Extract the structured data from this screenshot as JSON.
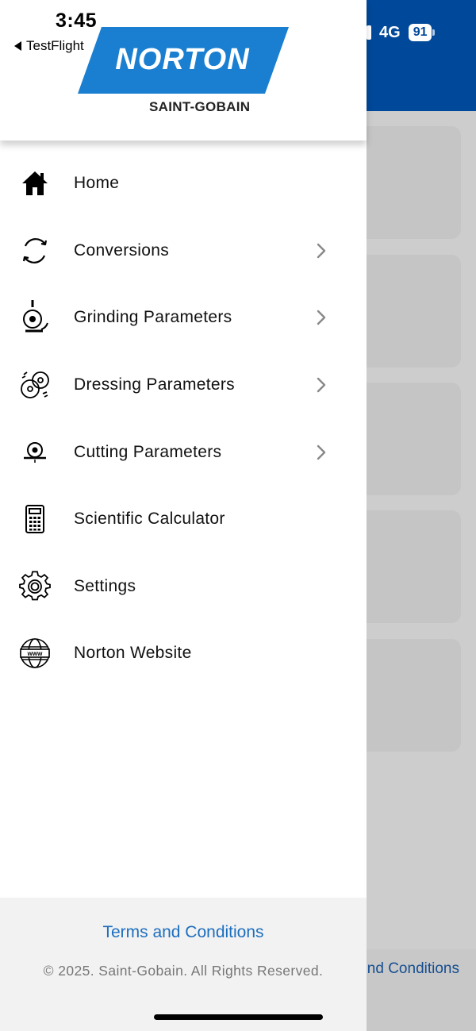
{
  "status_bar": {
    "time": "3:45",
    "back_app": "TestFlight",
    "network": "4G",
    "battery": "91"
  },
  "logo": {
    "brand": "NORTON",
    "registered": "®",
    "sub": "SAINT-GOBAIN",
    "brand_color": "#1a7fd0"
  },
  "menu": {
    "items": [
      {
        "label": "Home",
        "icon": "home-icon",
        "has_submenu": false
      },
      {
        "label": "Conversions",
        "icon": "refresh-icon",
        "has_submenu": true
      },
      {
        "label": "Grinding Parameters",
        "icon": "grinding-wheel-icon",
        "has_submenu": true
      },
      {
        "label": "Dressing Parameters",
        "icon": "dressing-wheels-icon",
        "has_submenu": true
      },
      {
        "label": "Cutting Parameters",
        "icon": "cutting-wheel-icon",
        "has_submenu": true
      },
      {
        "label": "Scientific Calculator",
        "icon": "calculator-icon",
        "has_submenu": false
      },
      {
        "label": "Settings",
        "icon": "gear-icon",
        "has_submenu": false
      },
      {
        "label": "Norton Website",
        "icon": "globe-www-icon",
        "has_submenu": false
      }
    ]
  },
  "footer": {
    "terms": "Terms and Conditions",
    "copyright": "© 2025. Saint-Gobain. All Rights Reserved."
  },
  "background": {
    "footer_terms_partial": "nd Conditions",
    "header_color": "#00489a"
  }
}
